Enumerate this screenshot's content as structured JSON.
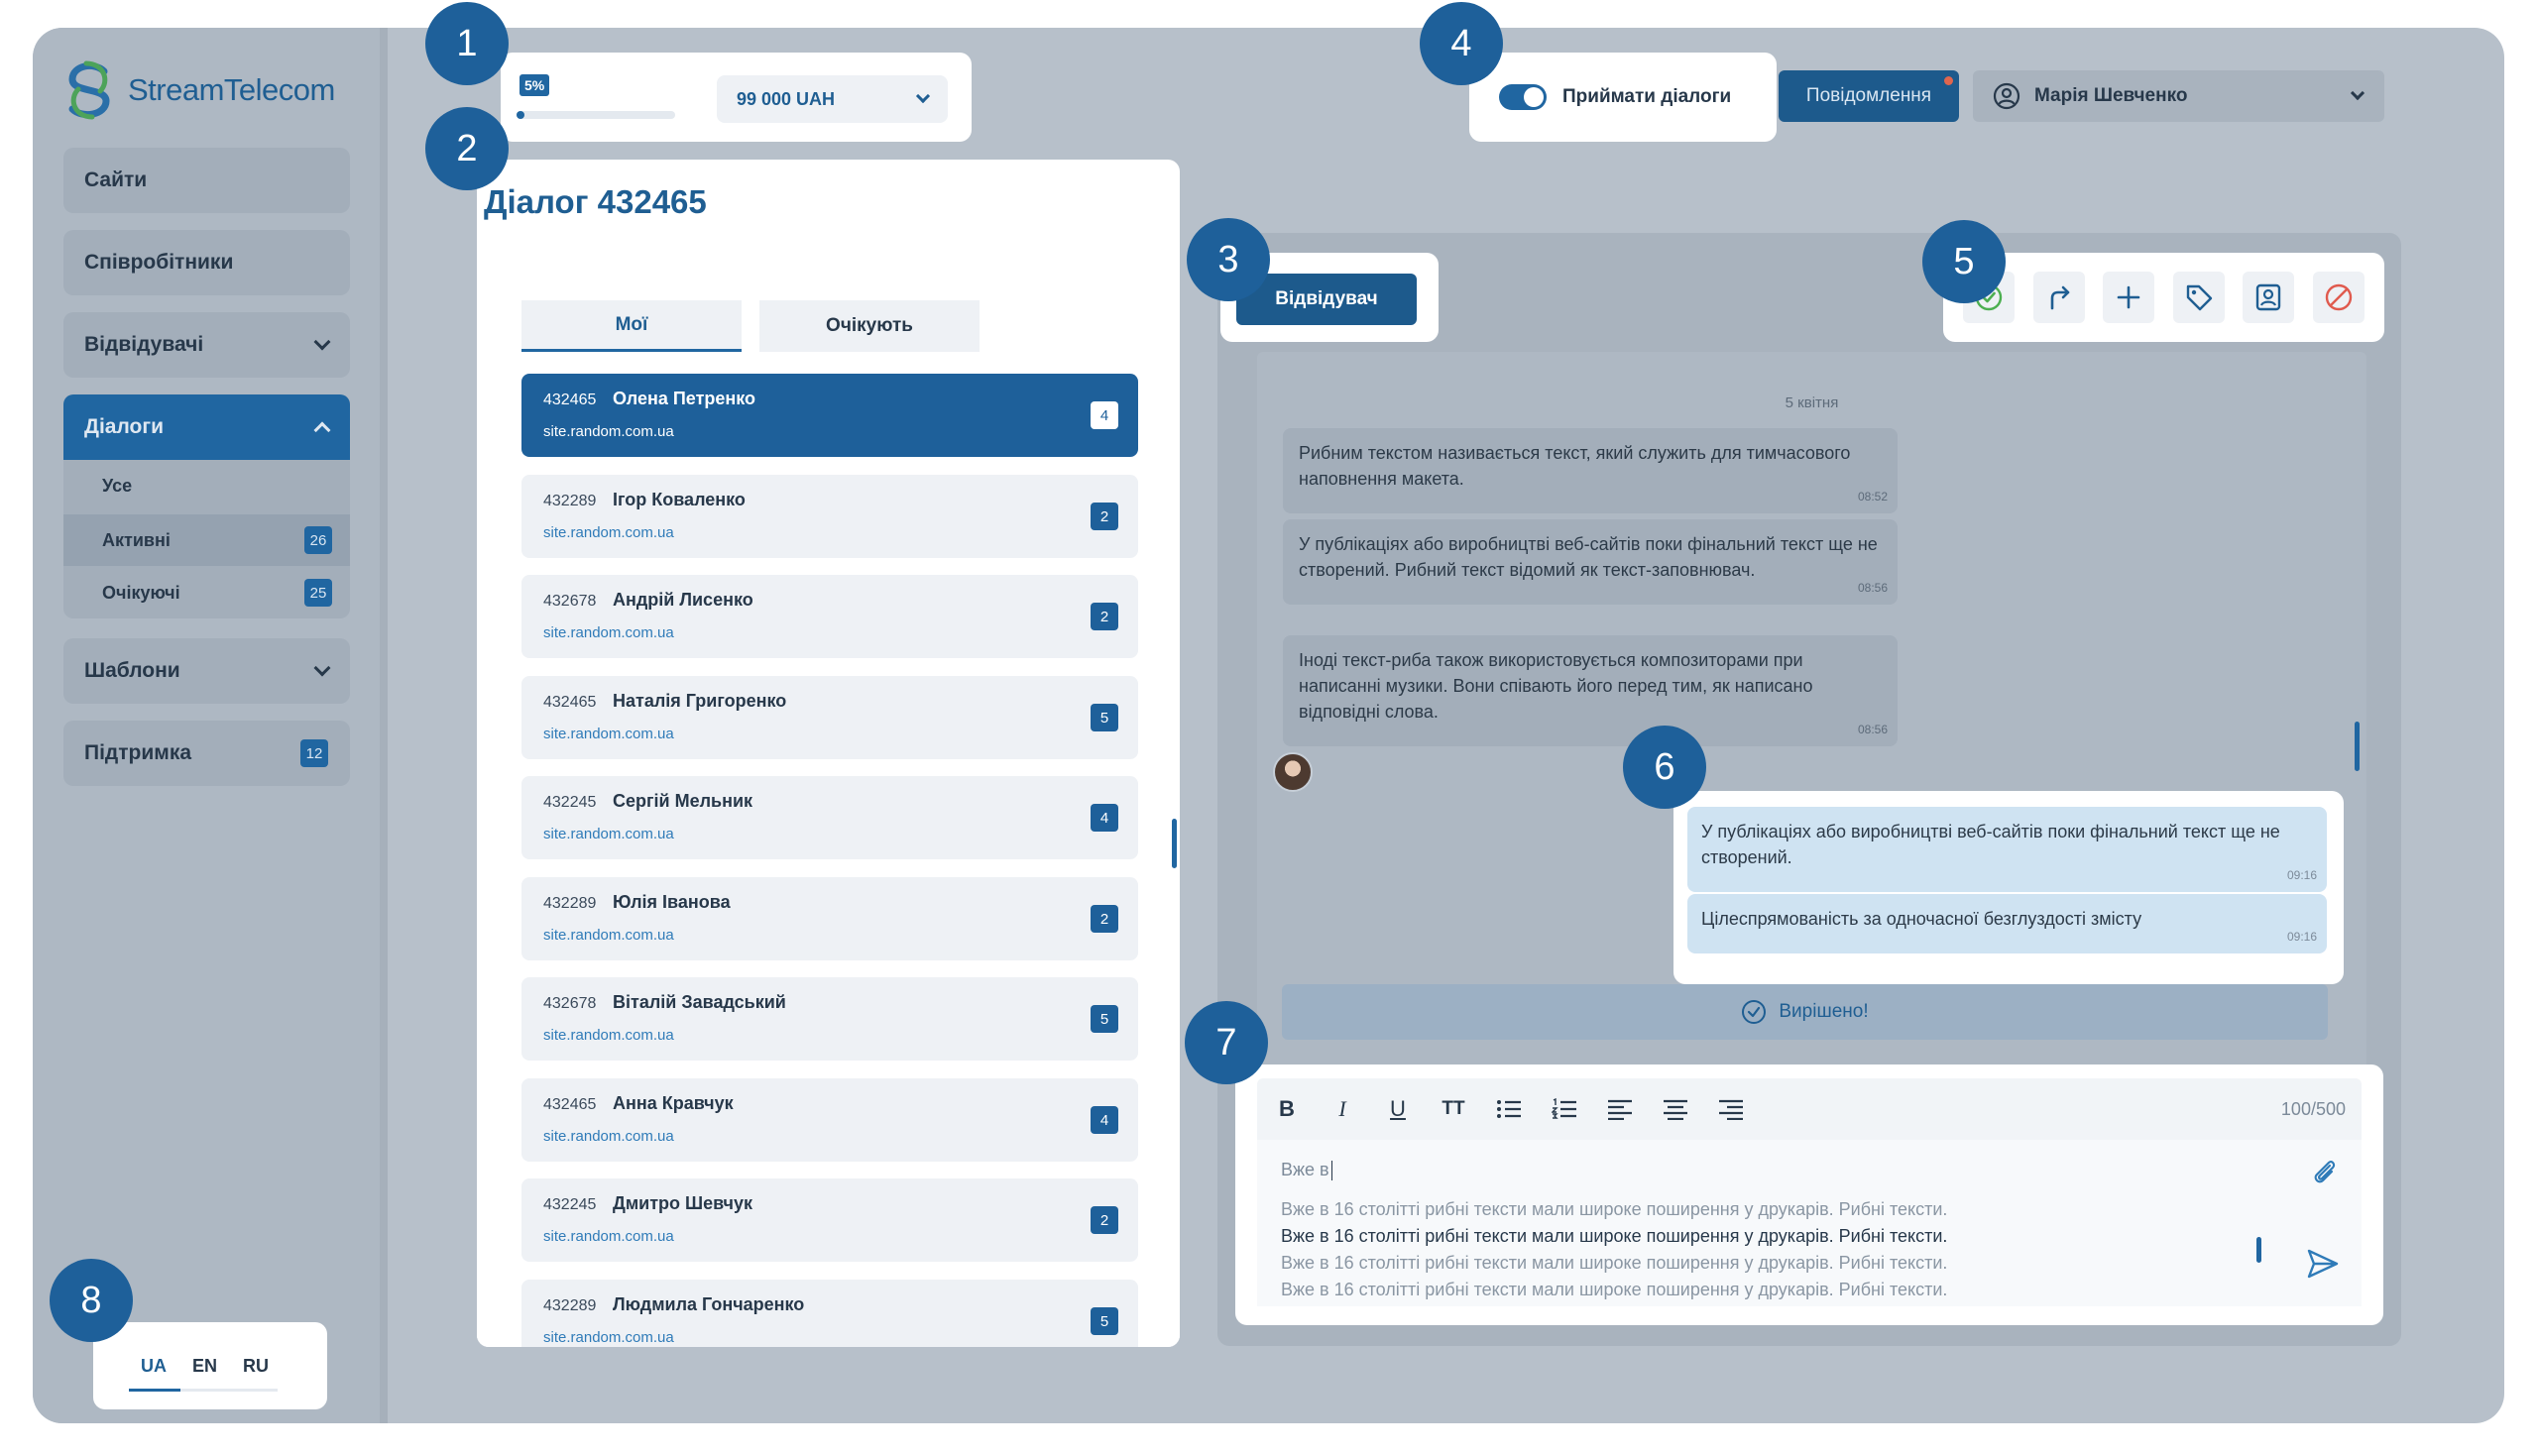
{
  "brand": {
    "name": "StreamTelecom"
  },
  "sidebar": {
    "items": [
      {
        "label": "Сайти"
      },
      {
        "label": "Співробітники"
      },
      {
        "label": "Відвідувачі"
      },
      {
        "label": "Діалоги"
      },
      {
        "label": "Шаблони"
      },
      {
        "label": "Підтримка",
        "count": "12"
      }
    ],
    "dialogs_sub": [
      {
        "label": "Усе"
      },
      {
        "label": "Активні",
        "count": "26"
      },
      {
        "label": "Очікуючі",
        "count": "25"
      }
    ]
  },
  "callouts": [
    "1",
    "2",
    "3",
    "4",
    "5",
    "6",
    "7",
    "8"
  ],
  "balance": {
    "percent_label": "5%",
    "progress": 0.05,
    "amount": "99 000 UAH"
  },
  "header": {
    "accept_label": "Приймати діалоги",
    "accept_on": true,
    "messages_label": "Повідомлення",
    "user_name": "Марія Шевченко"
  },
  "dialog": {
    "title": "Діалог 432465",
    "tabs": [
      {
        "label": "Мої"
      },
      {
        "label": "Очікують"
      }
    ],
    "list": [
      {
        "id": "432465",
        "name": "Олена Петренко",
        "site": "site.random.com.ua",
        "count": "4"
      },
      {
        "id": "432289",
        "name": "Ігор Коваленко",
        "site": "site.random.com.ua",
        "count": "2"
      },
      {
        "id": "432678",
        "name": "Андрій Лисенко",
        "site": "site.random.com.ua",
        "count": "2"
      },
      {
        "id": "432465",
        "name": "Наталія Григоренко",
        "site": "site.random.com.ua",
        "count": "5"
      },
      {
        "id": "432245",
        "name": "Сергій Мельник",
        "site": "site.random.com.ua",
        "count": "4"
      },
      {
        "id": "432289",
        "name": "Юлія Іванова",
        "site": "site.random.com.ua",
        "count": "2"
      },
      {
        "id": "432678",
        "name": "Віталій Завадський",
        "site": "site.random.com.ua",
        "count": "5"
      },
      {
        "id": "432465",
        "name": "Анна Кравчук",
        "site": "site.random.com.ua",
        "count": "4"
      },
      {
        "id": "432245",
        "name": "Дмитро Шевчук",
        "site": "site.random.com.ua",
        "count": "2"
      },
      {
        "id": "432289",
        "name": "Людмила Гончаренко",
        "site": "site.random.com.ua",
        "count": "5"
      }
    ]
  },
  "chat": {
    "visitor_label": "Відвідувач",
    "date": "5 квітня",
    "incoming": [
      {
        "text": "Рибним текстом називається текст, який служить для тимчасового наповнення макета.",
        "time": "08:52"
      },
      {
        "text": "У публікаціях або виробництві веб-сайтів поки фінальний текст ще не створений. Рибний текст відомий як текст-заповнювач.",
        "time": "08:56"
      },
      {
        "text": "Іноді текст-риба також використовується композиторами при написанні музики. Вони співають його перед тим, як написано відповідні слова.",
        "time": "08:56"
      }
    ],
    "outgoing": [
      {
        "text": "У публікаціях або виробництві веб-сайтів поки фінальний текст ще не створений.",
        "time": "09:16"
      },
      {
        "text": "Цілеспрямованість за одночасної безглуздості змісту",
        "time": "09:16"
      }
    ],
    "resolved_label": "Вирішено!",
    "actions": [
      "check-circle-icon",
      "forward-icon",
      "plus-icon",
      "tag-icon",
      "contact-card-icon",
      "block-icon"
    ]
  },
  "editor": {
    "counter": "100/500",
    "typed": "Вже в",
    "suggestions": [
      "Вже в 16 столітті рибні тексти мали широке поширення у друкарів. Рибні тексти.",
      "Вже в 16 столітті рибні тексти мали широке поширення у друкарів. Рибні тексти.",
      "Вже в 16 столітті рибні тексти мали широке поширення у друкарів. Рибні тексти.",
      "Вже в 16 столітті рибні тексти мали широке поширення у друкарів. Рибні тексти."
    ],
    "toolbar": [
      "B",
      "I",
      "U",
      "TT"
    ]
  },
  "language": {
    "options": [
      "UA",
      "EN",
      "RU"
    ],
    "selected": "UA"
  },
  "colors": {
    "primary": "#2066a1",
    "overlay": "#b7c0ca",
    "callout": "#1e609a"
  }
}
